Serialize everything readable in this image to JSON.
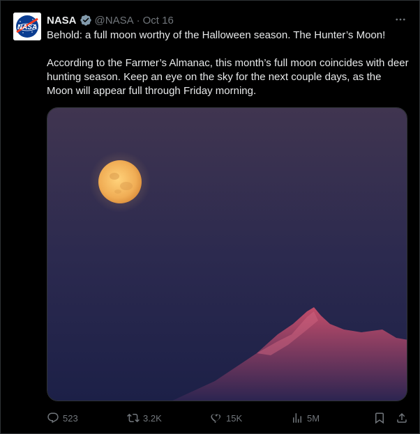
{
  "post": {
    "author_name": "NASA",
    "handle": "@NASA",
    "separator": "·",
    "date": "Oct 16",
    "paragraphs": [
      "Behold: a full moon worthy of the Halloween season. The Hunter’s Moon!",
      "According to the Farmer’s Almanac, this month’s full moon coincides with deer hunting season. Keep an eye on the sky for the next couple days, as the Moon will appear full through Friday morning."
    ]
  },
  "avatar": {
    "icon": "nasa-meatball-logo",
    "logo_text": "NASA"
  },
  "icons": {
    "verified": "verified-badge-icon",
    "more": "more-dots-icon",
    "reply": "reply-icon",
    "repost": "repost-icon",
    "like": "heart-icon",
    "views": "views-icon",
    "bookmark": "bookmark-icon",
    "share": "share-icon"
  },
  "actions": {
    "replies": "523",
    "reposts": "3.2K",
    "likes": "15K",
    "views": "5M"
  },
  "colors": {
    "background": "#000000",
    "text": "#e7e9ea",
    "muted": "#71767b",
    "border": "#2f3336",
    "sky_top": "#3f3650",
    "sky_bottom": "#1e2148",
    "moon": "#f2b45a",
    "mountain": "#b84a66"
  }
}
